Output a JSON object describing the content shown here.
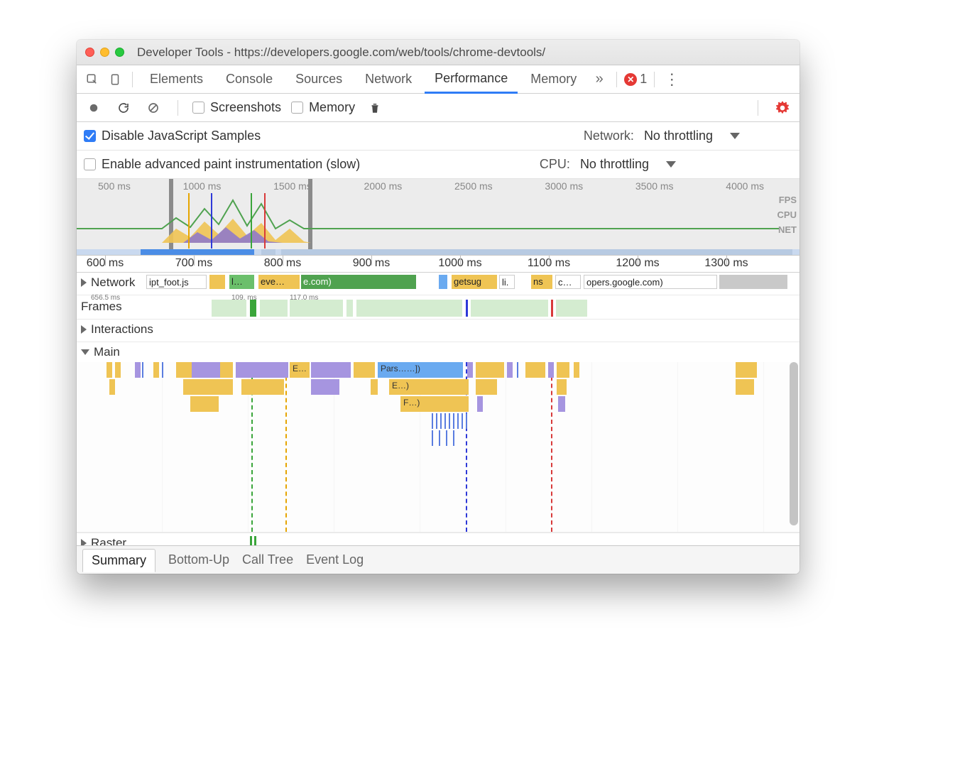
{
  "window": {
    "title": "Developer Tools - https://developers.google.com/web/tools/chrome-devtools/"
  },
  "tabs": {
    "elements": "Elements",
    "console": "Console",
    "sources": "Sources",
    "network": "Network",
    "performance": "Performance",
    "memory": "Memory"
  },
  "errors": {
    "count": "1"
  },
  "toolbar": {
    "screenshots": "Screenshots",
    "memory": "Memory"
  },
  "options": {
    "disable_js": "Disable JavaScript Samples",
    "enable_paint": "Enable advanced paint instrumentation (slow)",
    "network_label": "Network:",
    "cpu_label": "CPU:",
    "network_value": "No throttling",
    "cpu_value": "No throttling"
  },
  "overview": {
    "ticks": [
      "500 ms",
      "1000 ms",
      "1500 ms",
      "2000 ms",
      "2500 ms",
      "3000 ms",
      "3500 ms",
      "4000 ms"
    ],
    "lanes": {
      "fps": "FPS",
      "cpu": "CPU",
      "net": "NET"
    }
  },
  "ruler": {
    "ticks": [
      "600 ms",
      "700 ms",
      "800 ms",
      "900 ms",
      "1000 ms",
      "1100 ms",
      "1200 ms",
      "1300 ms"
    ]
  },
  "rows": {
    "network": "Network",
    "frames": "Frames",
    "interactions": "Interactions",
    "main": "Main",
    "raster": "Raster"
  },
  "network_items": {
    "a": "ipt_foot.js",
    "b": "l…",
    "c": "eve…",
    "d": "e.com)",
    "e": "getsug",
    "f": "li.",
    "g": "ns",
    "h": "c…",
    "i": "opers.google.com)"
  },
  "frame_labels": {
    "a": "656.5 ms",
    "b": "109.  ms",
    "c": "117.0 ms"
  },
  "flame_labels": {
    "e": "E…",
    "pars": "Pars……])",
    "e2": "E…)",
    "f": "F…)"
  },
  "bottom_tabs": {
    "summary": "Summary",
    "bottomup": "Bottom-Up",
    "calltree": "Call Tree",
    "eventlog": "Event Log"
  }
}
